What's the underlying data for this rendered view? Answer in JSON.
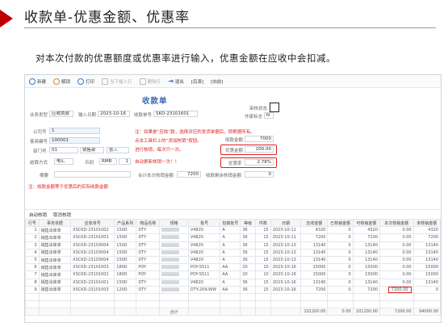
{
  "slide": {
    "title": "收款单-优惠金额、优惠率",
    "description": "对本次付款的优惠额度或优惠率进行输入，优惠金额在应收中会扣减。"
  },
  "toolbar": {
    "items": [
      {
        "label": "新建",
        "icon": "new-icon"
      },
      {
        "label": "解锁",
        "icon": "unlock-icon"
      },
      {
        "label": "打印",
        "icon": "print-icon"
      },
      {
        "label": "当下插入行",
        "icon": "insert-row-icon"
      },
      {
        "label": "删除行",
        "icon": "delete-row-icon"
      },
      {
        "label": "退出",
        "icon": "exit-icon"
      },
      {
        "label": "[后滚]"
      },
      {
        "label": "[向前]"
      }
    ]
  },
  "form": {
    "title": "收款单",
    "biz_type_label": "业务类型",
    "biz_type_value": "应收类款",
    "date_label": "输入日期",
    "date_value": "2023-10-16",
    "doc_no_label": "收款单号",
    "doc_no_value": "SKD-23101601",
    "audit_label": "审核状态",
    "print_label": "作废标志",
    "print_value": "N",
    "company_label": "公司号",
    "company_value": "1",
    "customer_label": "客商编号",
    "customer_value": "100001",
    "dept_label": "部门号",
    "dept_value": "01",
    "dept_name": "销售部",
    "staff_name": "张三",
    "settle_label": "结算方式",
    "settle_value": "电汇",
    "currency_label": "币别",
    "currency_value": "RMB",
    "rate_value": "1",
    "memo_label": "摘要",
    "unpaid_label": "合计本次核销金额",
    "unpaid_value": "7200",
    "balance_label": "收款剩余核销金额",
    "balance_value": "0",
    "amount_label": "收款金额",
    "amount_value": "7000",
    "discount_label": "优惠金额",
    "discount_value": "200.00",
    "rate_label": "优惠率",
    "rate_pct_value": "2.78%",
    "notes": [
      "注：如果是“应收”款，选择对应的发货单据后，即根据所有。",
      "点击工具栏上的“添加核销”按钮。",
      "进行核销，每次只一次。",
      "自动更新核销一次！！"
    ],
    "bottom_note": "注：收款金额等于优惠后的实际收款金额"
  },
  "tabs": [
    "自动核销",
    "取消核销"
  ],
  "table": {
    "headers": [
      "行号",
      "事务单据",
      "应收单号",
      "产品系列",
      "物品名称",
      "规格",
      "批号",
      "包装批号",
      "等级",
      "件数",
      "日期",
      "应收金额",
      "已核销金额",
      "可核销金额",
      "本次核销金额",
      "未核销金额"
    ],
    "rows": [
      [
        "1",
        "销售出库单",
        "XSCKD-23101002",
        "150D",
        "DTY",
        "",
        "V4820",
        "A",
        "36",
        "15",
        "2023-10-11",
        "4320",
        "0",
        "4320",
        "0.00",
        "4320"
      ],
      [
        "2",
        "销售出库单",
        "XSCKD-23101001",
        "150D",
        "DTY",
        "",
        "V4820",
        "A",
        "36",
        "15",
        "2023-10-11",
        "7200",
        "0",
        "7200",
        "0.00",
        "7200"
      ],
      [
        "3",
        "销售出库单",
        "XSCKD-23103004",
        "150D",
        "DTY",
        "",
        "V4820",
        "A",
        "36",
        "15",
        "2023-10-13",
        "13140",
        "0",
        "13140",
        "0.00",
        "13140"
      ],
      [
        "4",
        "销售出库单",
        "XSCKD-23103004",
        "150D",
        "DTY",
        "",
        "V4820",
        "A",
        "36",
        "15",
        "2023-10-13",
        "13140",
        "0",
        "13140",
        "0.00",
        "13140"
      ],
      [
        "5",
        "销售出库单",
        "XSCKD-23103004",
        "150D",
        "DTY",
        "",
        "V4820",
        "A",
        "36",
        "15",
        "2023-10-13",
        "13140",
        "0",
        "13140",
        "0.00",
        "13140"
      ],
      [
        "6",
        "销售出库单",
        "XSCKD-23101003",
        "180D",
        "POY",
        "",
        "POY-S511",
        "AA",
        "20",
        "10",
        "2023-10-16",
        "15000",
        "0",
        "15000",
        "0.00",
        "15000"
      ],
      [
        "7",
        "销售出库单",
        "XSCKD-23101002",
        "180D",
        "POY",
        "",
        "POY-S511",
        "AA",
        "20",
        "10",
        "2023-10-16",
        "15000",
        "0",
        "15000",
        "0.00",
        "15000"
      ],
      [
        "8",
        "销售出库单",
        "XSCKD-23101001",
        "150D",
        "DTY",
        "",
        "V4820",
        "A",
        "36",
        "15",
        "2023-10-16",
        "13140",
        "0",
        "13140",
        "0.00",
        "13140"
      ],
      [
        "9",
        "销售出库单",
        "XSCKD-23101003",
        "120D",
        "DTY",
        "",
        "DTY-209-WW",
        "AA",
        "36",
        "15",
        "2023-10-16",
        "7200",
        "0",
        "7200",
        "7200.00",
        "0"
      ]
    ],
    "sum_label": "合计",
    "sums": [
      "101200.00",
      "0.00",
      "101200.00",
      "7200.00",
      "94000.00"
    ]
  },
  "colors": {
    "accent": "#c00000",
    "link": "#3b66b5",
    "highlight": "#e02020"
  }
}
